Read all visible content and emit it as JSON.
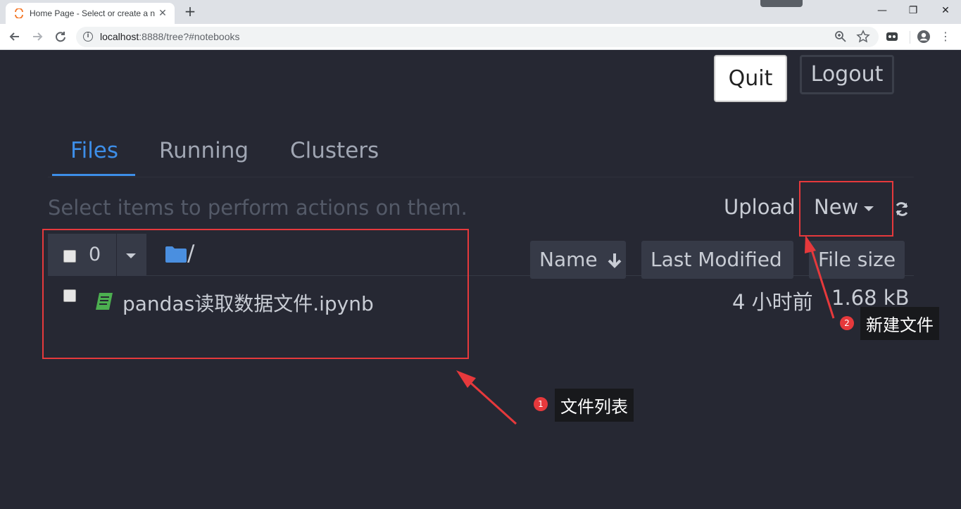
{
  "browser": {
    "tab_title": "Home Page - Select or create a notebook",
    "tab_close": "✕",
    "new_tab": "+",
    "window_controls": {
      "minimize": "—",
      "restore": "❐",
      "close": "✕"
    },
    "url_host": "localhost",
    "url_rest": ":8888/tree?#notebooks",
    "icons": [
      "back-arrow-icon",
      "forward-arrow-icon",
      "reload-icon",
      "info-icon",
      "zoom-icon",
      "star-icon",
      "extension-icon",
      "profile-icon",
      "menu-dots-icon"
    ]
  },
  "header": {
    "quit_label": "Quit",
    "logout_label": "Logout"
  },
  "tabs": [
    {
      "label": "Files",
      "active": true
    },
    {
      "label": "Running",
      "active": false
    },
    {
      "label": "Clusters",
      "active": false
    }
  ],
  "toolbar": {
    "hint": "Select items to perform actions on them.",
    "upload_label": "Upload",
    "new_label": "New"
  },
  "list_header": {
    "selected_count": "0",
    "breadcrumb": "/",
    "sort_name": "Name",
    "sort_modified": "Last Modified",
    "sort_size": "File size"
  },
  "files": [
    {
      "name": "pandas读取数据文件.ipynb",
      "modified": "4 小时前",
      "size": "1.68 kB"
    }
  ],
  "annotations": [
    {
      "number": "1",
      "label": "文件列表"
    },
    {
      "number": "2",
      "label": "新建文件"
    }
  ],
  "colors": {
    "background": "#262833",
    "accent": "#3d8ee8",
    "annotation": "#e6393c",
    "notebook_icon": "#4caf50",
    "folder_icon": "#4a8fe0"
  }
}
